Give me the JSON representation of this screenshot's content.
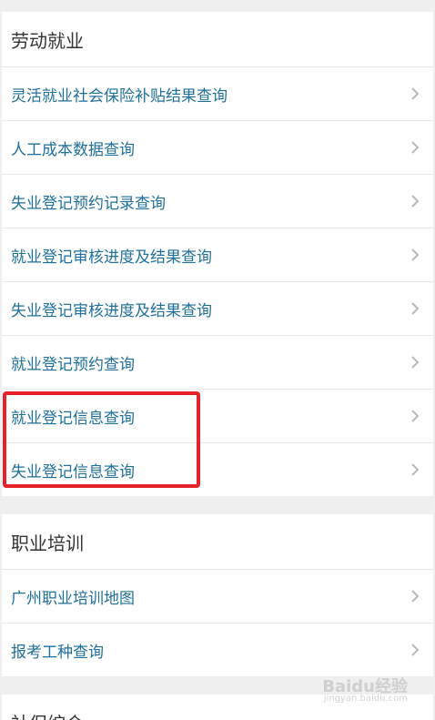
{
  "sections": [
    {
      "title": "劳动就业",
      "items": [
        {
          "label": "灵活就业社会保险补贴结果查询"
        },
        {
          "label": "人工成本数据查询"
        },
        {
          "label": "失业登记预约记录查询"
        },
        {
          "label": "就业登记审核进度及结果查询"
        },
        {
          "label": "失业登记审核进度及结果查询"
        },
        {
          "label": "就业登记预约查询"
        },
        {
          "label": "就业登记信息查询"
        },
        {
          "label": "失业登记信息查询"
        }
      ]
    },
    {
      "title": "职业培训",
      "items": [
        {
          "label": "广州职业培训地图"
        },
        {
          "label": "报考工种查询"
        }
      ]
    },
    {
      "title": "社保综合",
      "items": []
    }
  ],
  "watermark": {
    "main": "Baidu经验",
    "sub": "jingyan.baidu.com"
  },
  "colors": {
    "link": "#1e6f9a",
    "highlight": "#e5222a"
  }
}
